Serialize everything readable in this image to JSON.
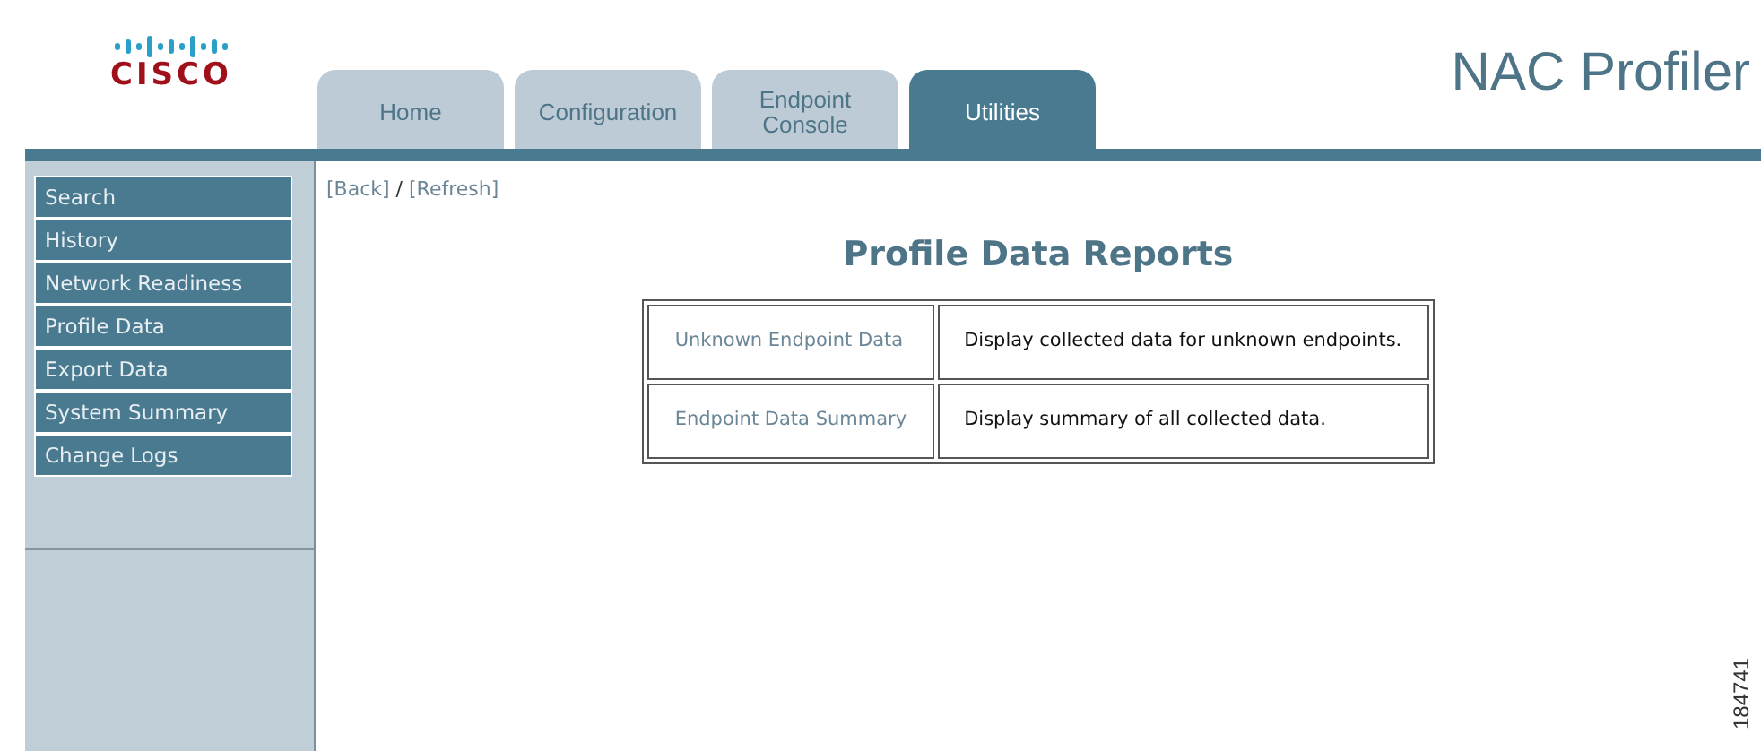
{
  "logo": {
    "word": "CISCO"
  },
  "product": "NAC Profiler",
  "tabs": [
    {
      "label": "Home",
      "selected": false
    },
    {
      "label": "Configuration",
      "selected": false
    },
    {
      "label": "Endpoint Console",
      "selected": false
    },
    {
      "label": "Utilities",
      "selected": true
    }
  ],
  "sidebar": {
    "items": [
      "Search",
      "History",
      "Network Readiness",
      "Profile Data",
      "Export Data",
      "System Summary",
      "Change Logs"
    ]
  },
  "breadcrumb": {
    "links": [
      "[Back]",
      "[Refresh]"
    ],
    "separator": "/"
  },
  "heading": "Profile Data Reports",
  "reports": [
    {
      "link": "Unknown Endpoint Data",
      "description": "Display collected data for unknown endpoints."
    },
    {
      "link": "Endpoint Data Summary",
      "description": "Display summary of all collected data."
    }
  ],
  "figure_number": "184741"
}
